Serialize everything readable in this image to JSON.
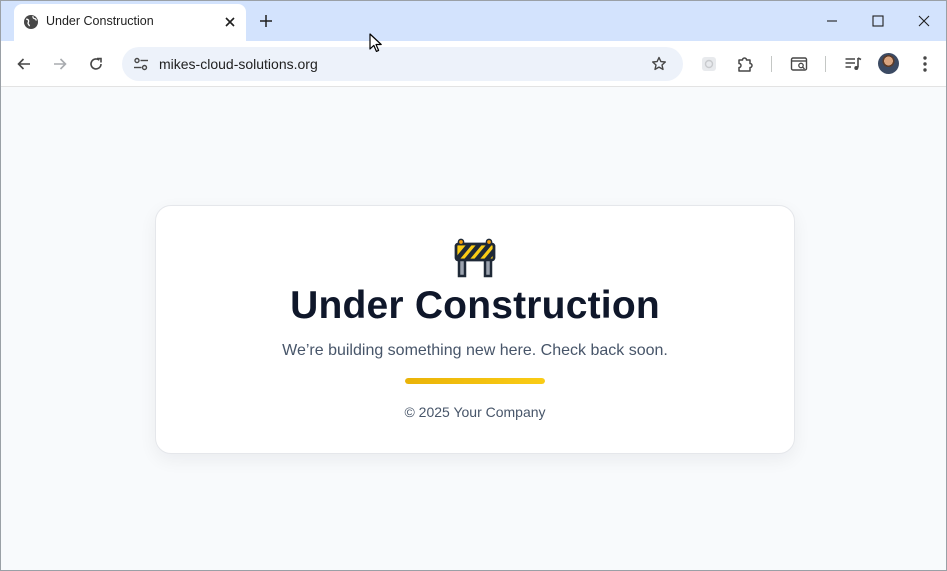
{
  "browser": {
    "tab": {
      "title": "Under Construction",
      "favicon": "globe-icon"
    },
    "address_bar": {
      "url": "mikes-cloud-solutions.org"
    },
    "icons": {
      "back": "arrow-left-icon",
      "forward": "arrow-right-icon",
      "reload": "reload-icon",
      "site_info": "tune-icon",
      "bookmark": "star-icon",
      "extension": "extension-puzzle-icon",
      "media": "media-controls-icon",
      "menu": "kebab-menu-icon"
    }
  },
  "page": {
    "icon": "construction-barrier-icon",
    "headline": "Under Construction",
    "subtext": "We’re building something new here. Check back soon.",
    "progress": 1.0,
    "footer": "© 2025 Your Company"
  },
  "colors": {
    "tabstrip": "#d3e3fd",
    "headline": "#0f172a",
    "accent": "#eab308",
    "page_background": "#f8fafc"
  }
}
